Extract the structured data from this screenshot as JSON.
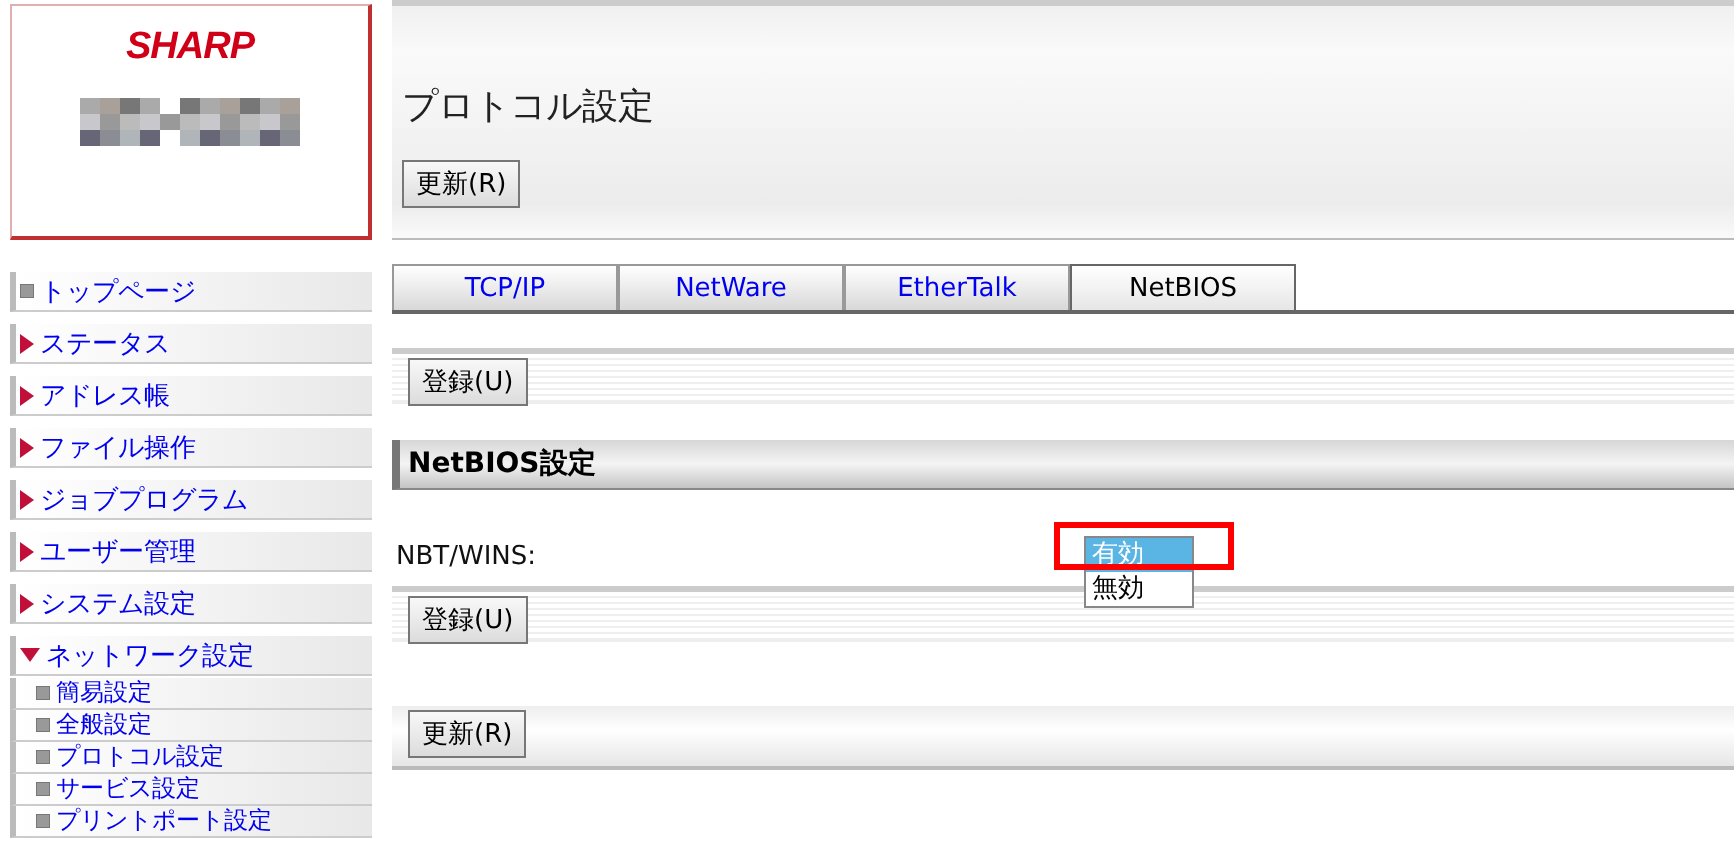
{
  "logo": {
    "brand": "SHARP",
    "kind": "picture"
  },
  "sidebar": {
    "items": [
      {
        "label": "トップページ",
        "kind": "leaf"
      },
      {
        "label": "ステータス",
        "kind": "folder",
        "expanded": false
      },
      {
        "label": "アドレス帳",
        "kind": "folder",
        "expanded": false
      },
      {
        "label": "ファイル操作",
        "kind": "folder",
        "expanded": false
      },
      {
        "label": "ジョブプログラム",
        "kind": "folder",
        "expanded": false
      },
      {
        "label": "ユーザー管理",
        "kind": "folder",
        "expanded": false
      },
      {
        "label": "システム設定",
        "kind": "folder",
        "expanded": false
      },
      {
        "label": "ネットワーク設定",
        "kind": "folder",
        "expanded": true,
        "children": [
          {
            "label": "簡易設定",
            "kind": "leaf"
          },
          {
            "label": "全般設定",
            "kind": "leaf"
          },
          {
            "label": "プロトコル設定",
            "kind": "leaf"
          },
          {
            "label": "サービス設定",
            "kind": "leaf"
          },
          {
            "label": "プリントポート設定",
            "kind": "leaf"
          }
        ]
      }
    ]
  },
  "header": {
    "title": "プロトコル設定",
    "refresh_button": "更新(R)"
  },
  "tabs": [
    {
      "label": "TCP/IP",
      "selected": false
    },
    {
      "label": "NetWare",
      "selected": false
    },
    {
      "label": "EtherTalk",
      "selected": false
    },
    {
      "label": "NetBIOS",
      "selected": true
    }
  ],
  "register_button_top": "登録(U)",
  "section": {
    "title": "NetBIOS設定",
    "fields": [
      {
        "label": "NBT/WINS:",
        "options": [
          {
            "label": "有効",
            "selected": true
          },
          {
            "label": "無効",
            "selected": false
          }
        ],
        "highlighted": true
      }
    ]
  },
  "register_button_bottom": "登録(U)",
  "refresh_button_bottom": "更新(R)"
}
